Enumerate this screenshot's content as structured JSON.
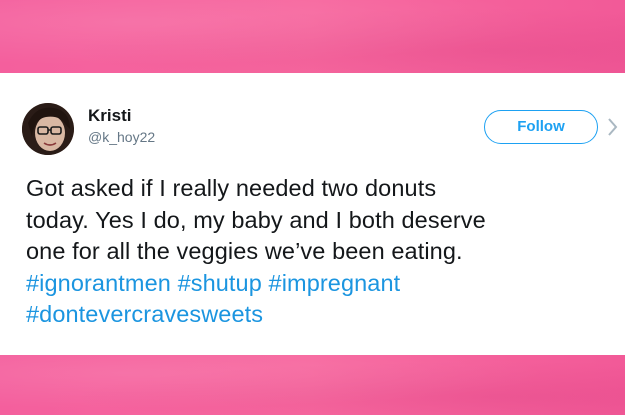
{
  "tweet": {
    "user": {
      "name": "Kristi",
      "handle": "@k_hoy22"
    },
    "follow_label": "Follow",
    "text_lines": [
      "Got asked if I really needed two donuts",
      "today. Yes I do, my baby and I both deserve",
      "one for all the veggies we’ve been eating."
    ],
    "hashtags": [
      "#ignorantmen",
      "#shutup",
      "#impregnant",
      "#dontevercravesweets"
    ]
  },
  "colors": {
    "background": "#f2639b",
    "card": "#ffffff",
    "accent": "#1da1f2",
    "hashtag": "#1b95e0",
    "text": "#14171a",
    "handle": "#657786"
  },
  "icons": {
    "avatar": "profile-photo",
    "more": "more-icon"
  }
}
